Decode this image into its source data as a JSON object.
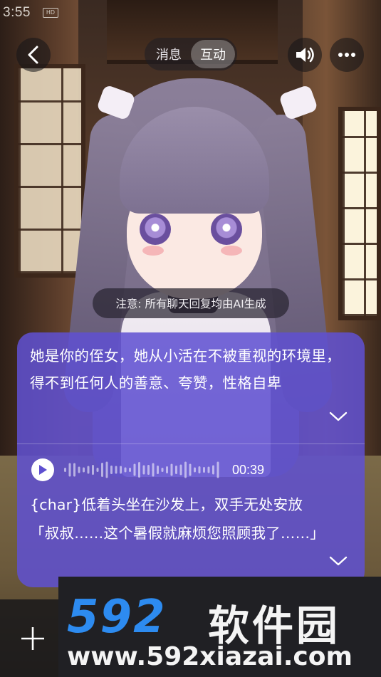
{
  "status_bar": {
    "time": "3:55",
    "badge": "HD"
  },
  "header": {
    "tabs": [
      {
        "label": "消息",
        "active": false
      },
      {
        "label": "互动",
        "active": true
      }
    ]
  },
  "notice": "注意: 所有聊天回复均由AI生成",
  "card": {
    "intro": "她是你的侄女，她从小活在不被重视的环境里，得不到任何人的善意、夸赞，性格自卑",
    "audio": {
      "duration": "00:39"
    },
    "message_lines": [
      "{char}低着头坐在沙发上，双手无处安放",
      "「叔叔……这个暑假就麻烦您照顾我了……」"
    ]
  },
  "watermark": {
    "brand": "592",
    "brand_cn": "软件园",
    "url": "www.592xiazai.com"
  },
  "icons": {
    "back": "chevron-left-icon",
    "sound": "speaker-icon",
    "more": "more-dots-icon",
    "play": "play-icon",
    "expand": "chevron-down-icon",
    "add": "plus-icon"
  }
}
